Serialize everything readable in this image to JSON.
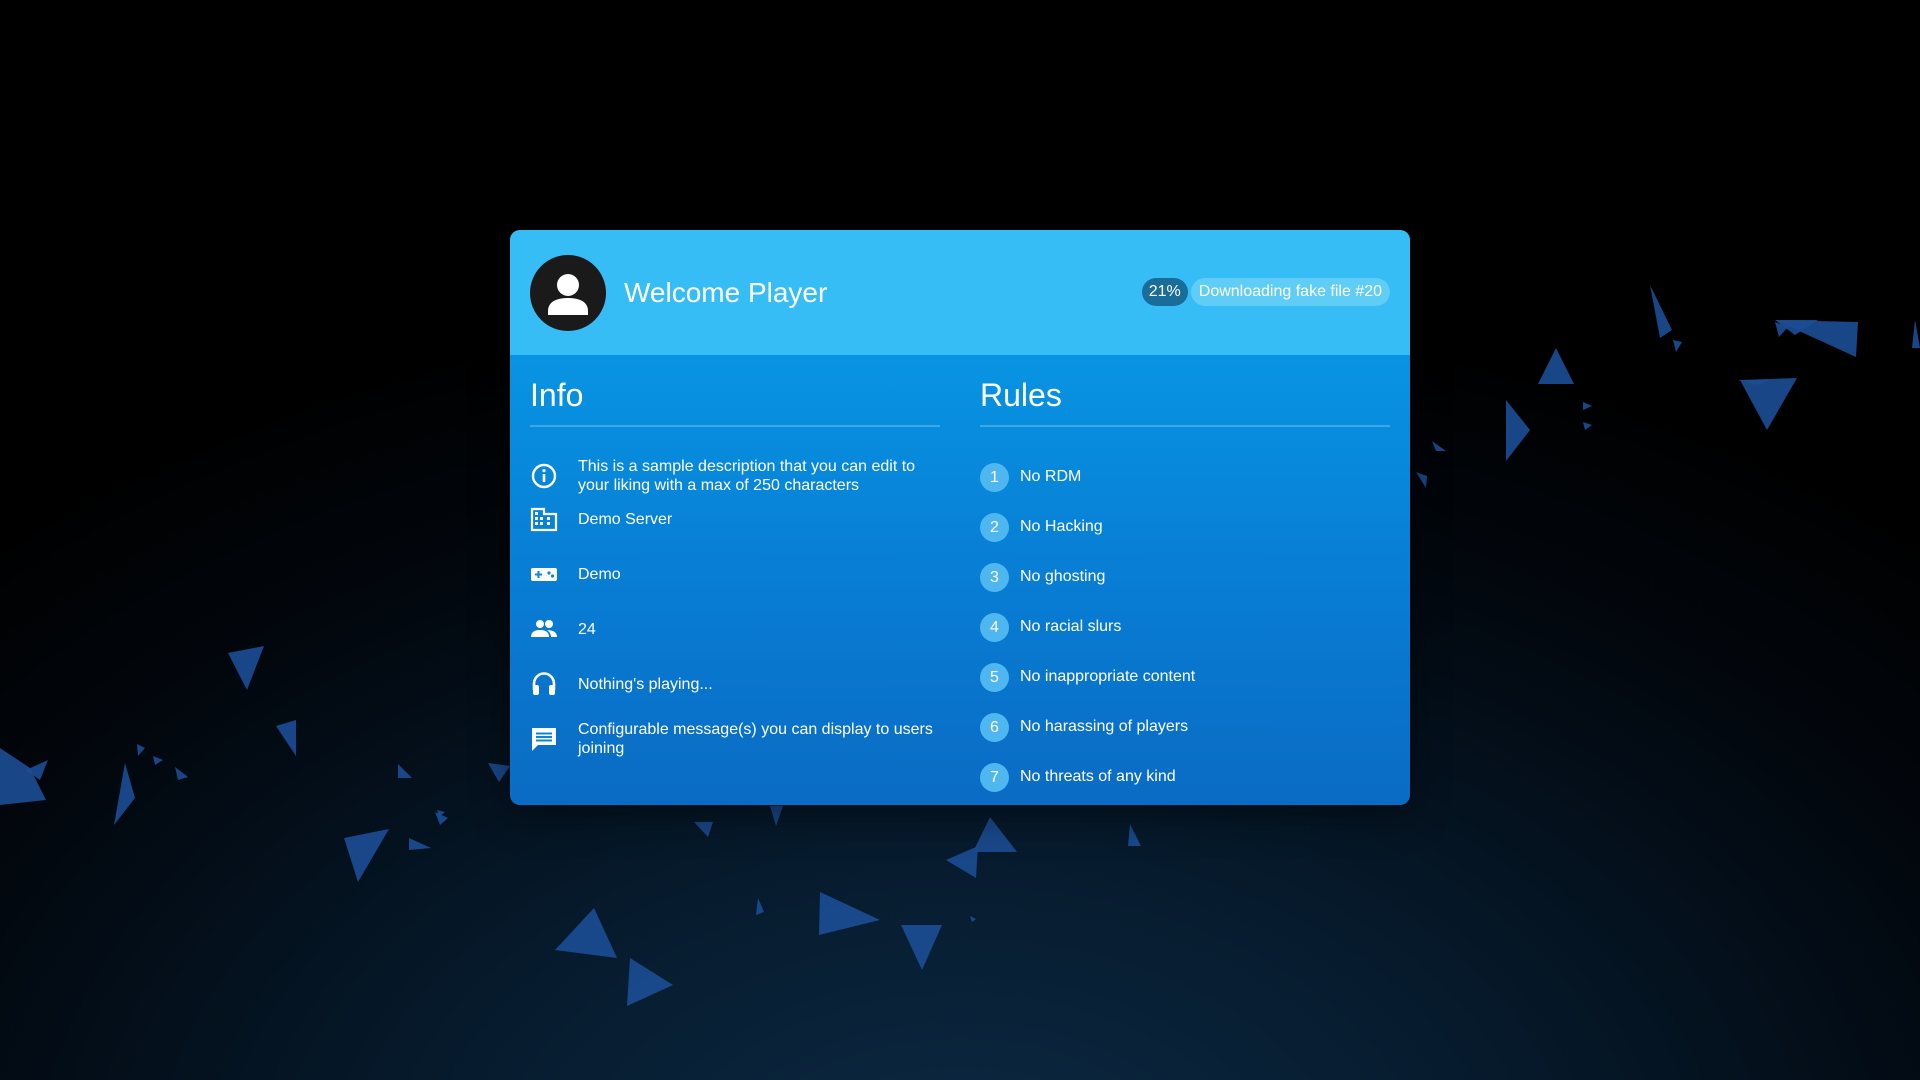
{
  "header": {
    "welcome_text": "Welcome Player",
    "progress_percent_label": "21%",
    "progress_value": 0.21,
    "download_status": "Downloading fake file #20"
  },
  "info": {
    "title": "Info",
    "items": [
      {
        "icon": "info-circle-icon",
        "text": "This is a sample description that you can edit to your liking with a max of 250 characters"
      },
      {
        "icon": "building-icon",
        "text": "Demo Server"
      },
      {
        "icon": "gamepad-icon",
        "text": "Demo"
      },
      {
        "icon": "people-icon",
        "text": "24"
      },
      {
        "icon": "headphones-icon",
        "text": "Nothing's playing..."
      },
      {
        "icon": "message-icon",
        "text": "Configurable message(s) you can display to users joining"
      }
    ]
  },
  "rules": {
    "title": "Rules",
    "items": [
      {
        "number": "1",
        "text": "No RDM"
      },
      {
        "number": "2",
        "text": "No Hacking"
      },
      {
        "number": "3",
        "text": "No ghosting"
      },
      {
        "number": "4",
        "text": "No racial slurs"
      },
      {
        "number": "5",
        "text": "No inappropriate content"
      },
      {
        "number": "6",
        "text": "No harassing of players"
      },
      {
        "number": "7",
        "text": "No threats of any kind"
      }
    ]
  },
  "colors": {
    "card_header": "#36bdf5",
    "card_body": "#0880d6",
    "rule_badge": "#4fb7ef",
    "percent_pill": "#1a6d99",
    "status_pill": "#5fcdf6",
    "shards": "#1b4c93"
  }
}
